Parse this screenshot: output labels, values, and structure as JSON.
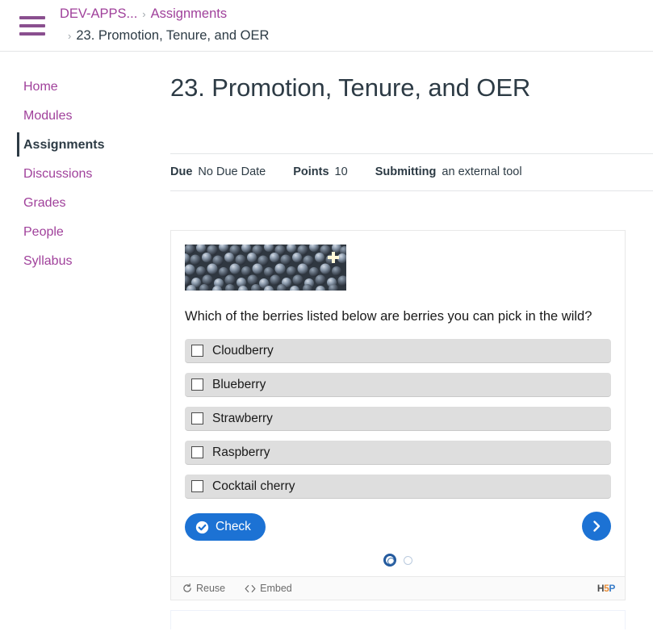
{
  "topbar": {
    "menu_icon": "hamburger-menu-icon",
    "breadcrumb": {
      "course": "DEV-APPS...",
      "section": "Assignments",
      "current": "23. Promotion, Tenure, and OER",
      "separator": "›"
    }
  },
  "sidebar": {
    "items": [
      {
        "label": "Home",
        "active": false
      },
      {
        "label": "Modules",
        "active": false
      },
      {
        "label": "Assignments",
        "active": true
      },
      {
        "label": "Discussions",
        "active": false
      },
      {
        "label": "Grades",
        "active": false
      },
      {
        "label": "People",
        "active": false
      },
      {
        "label": "Syllabus",
        "active": false
      }
    ]
  },
  "main": {
    "title": "23. Promotion, Tenure, and OER",
    "meta": {
      "due_label": "Due",
      "due_value": "No Due Date",
      "points_label": "Points",
      "points_value": "10",
      "submitting_label": "Submitting",
      "submitting_value": "an external tool"
    }
  },
  "h5p": {
    "image_alt": "blueberries",
    "zoom_icon": "expand-plus-icon",
    "question": "Which of the berries listed below are berries you can pick in the wild?",
    "options": [
      {
        "label": "Cloudberry",
        "checked": false
      },
      {
        "label": "Blueberry",
        "checked": false
      },
      {
        "label": "Strawberry",
        "checked": false
      },
      {
        "label": "Raspberry",
        "checked": false
      },
      {
        "label": "Cocktail cherry",
        "checked": false
      }
    ],
    "check_button": "Check",
    "check_icon": "check-circle-icon",
    "next_icon": "chevron-right-icon",
    "pagination": {
      "total": 2,
      "current": 1
    },
    "footer": {
      "reuse": "Reuse",
      "reuse_icon": "refresh-icon",
      "embed": "Embed",
      "embed_icon": "code-brackets-icon",
      "logo_h": "H",
      "logo_5": "5",
      "logo_p": "P"
    }
  },
  "colors": {
    "link": "#a0419b",
    "text": "#2d3b45",
    "accent_blue": "#1c72d4",
    "option_bg": "#dedede"
  }
}
